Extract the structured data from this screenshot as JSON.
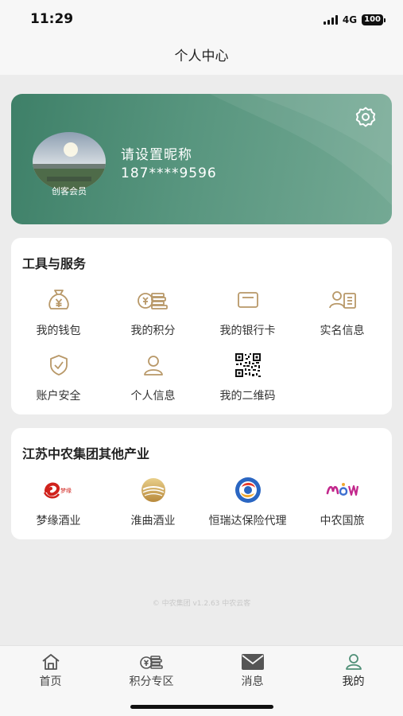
{
  "status_bar": {
    "time": "11:29",
    "network": "4G",
    "battery": "100"
  },
  "header": {
    "title": "个人中心"
  },
  "profile": {
    "nickname": "请设置昵称",
    "phone": "187****9596",
    "member_level": "创客会员",
    "settings_icon": "gear-icon"
  },
  "tools": {
    "title": "工具与服务",
    "items": [
      {
        "label": "我的钱包",
        "icon": "money-bag-icon"
      },
      {
        "label": "我的积分",
        "icon": "coins-icon"
      },
      {
        "label": "我的银行卡",
        "icon": "bank-card-icon"
      },
      {
        "label": "实名信息",
        "icon": "id-card-icon"
      },
      {
        "label": "账户安全",
        "icon": "shield-check-icon"
      },
      {
        "label": "个人信息",
        "icon": "user-icon"
      },
      {
        "label": "我的二维码",
        "icon": "qr-code-icon"
      }
    ]
  },
  "industries": {
    "title": "江苏中农集团其他产业",
    "items": [
      {
        "label": "梦缘酒业",
        "icon": "mengyuan-logo"
      },
      {
        "label": "淮曲酒业",
        "icon": "huaiqu-logo"
      },
      {
        "label": "恒瑞达保险代理",
        "icon": "hengruida-logo"
      },
      {
        "label": "中农国旅",
        "icon": "zhongnong-travel-logo"
      }
    ]
  },
  "footer": {
    "copyright": "© 中农集团 v1.2.63 中农云客"
  },
  "tabbar": {
    "items": [
      {
        "label": "首页",
        "icon": "home-icon"
      },
      {
        "label": "积分专区",
        "icon": "coins-icon"
      },
      {
        "label": "消息",
        "icon": "mail-icon"
      },
      {
        "label": "我的",
        "icon": "user-icon"
      }
    ],
    "active_index": 3
  },
  "colors": {
    "brand_green": "#4f8f77",
    "icon_gold": "#b89868"
  }
}
